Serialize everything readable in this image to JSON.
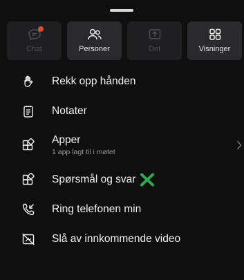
{
  "tiles": [
    {
      "label": "Chat",
      "icon": "chat-icon",
      "enabled": false,
      "has_badge": true,
      "badge_color": "#e14b36"
    },
    {
      "label": "Personer",
      "icon": "people-icon",
      "enabled": true
    },
    {
      "label": "Del",
      "icon": "share-icon",
      "enabled": false
    },
    {
      "label": "Visninger",
      "icon": "grid-icon",
      "enabled": true
    }
  ],
  "menu": [
    {
      "label": "Rekk opp hånden",
      "icon": "raise-hand-icon"
    },
    {
      "label": "Notater",
      "icon": "notes-icon"
    },
    {
      "label": "Apper",
      "sublabel": "1 app lagt til i møtet",
      "icon": "apps-icon",
      "has_chevron": true
    },
    {
      "label": "Spørsmål og svar",
      "icon": "apps-icon",
      "annotation_icon": "green-x-mark"
    },
    {
      "label": "Ring telefonen min",
      "icon": "phone-callback-icon"
    },
    {
      "label": "Slå av innkommende video",
      "icon": "video-off-icon"
    }
  ],
  "colors": {
    "background": "#0f0f10",
    "tile": "#2a2a2d",
    "tile_disabled": "#1f1f21",
    "text": "#f2f2f2",
    "muted": "#9a9a9c",
    "accent_green": "#2fa84f"
  }
}
